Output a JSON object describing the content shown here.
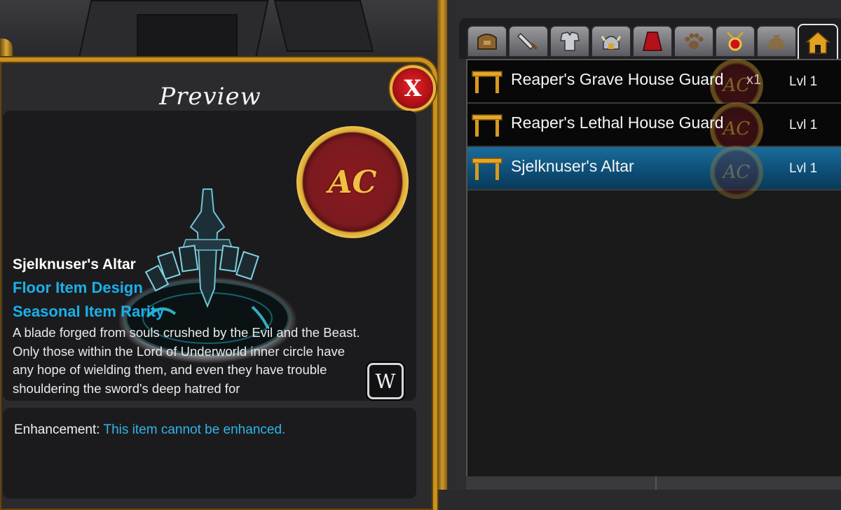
{
  "preview": {
    "title": "Preview",
    "close_label": "X",
    "item": {
      "name": "Sjelknuser's Altar",
      "type": "Floor Item Design",
      "rarity": "Seasonal Item Rarity",
      "description": "A blade forged from souls crushed by the Evil and the Beast. Only those within the Lord of Underworld inner circle have any hope of wielding them, and even they have trouble shouldering the sword's deep hatred for"
    },
    "currency_badge": "AC",
    "wiki_button": "W",
    "enhancement": {
      "label": "Enhancement:",
      "value": "This item cannot be enhanced."
    }
  },
  "inventory": {
    "tabs": [
      {
        "icon": "bag-icon"
      },
      {
        "icon": "sword-icon"
      },
      {
        "icon": "armor-icon"
      },
      {
        "icon": "helm-icon"
      },
      {
        "icon": "cape-icon"
      },
      {
        "icon": "pet-paw-icon"
      },
      {
        "icon": "amulet-icon"
      },
      {
        "icon": "item-sack-icon"
      },
      {
        "icon": "house-icon",
        "active": true
      }
    ],
    "items": [
      {
        "name": "Reaper's Grave House Guard",
        "qty": "x1",
        "level": "Lvl 1",
        "selected": false
      },
      {
        "name": "Reaper's Lethal House Guard",
        "qty": "",
        "level": "Lvl 1",
        "selected": false
      },
      {
        "name": "Sjelknuser's Altar",
        "qty": "",
        "level": "Lvl 1",
        "selected": true
      }
    ]
  },
  "colors": {
    "gold_frame": "#c9921f",
    "accent_blue": "#1ab0ea",
    "selected_row": "#0e4f78",
    "close_red": "#b01217"
  }
}
